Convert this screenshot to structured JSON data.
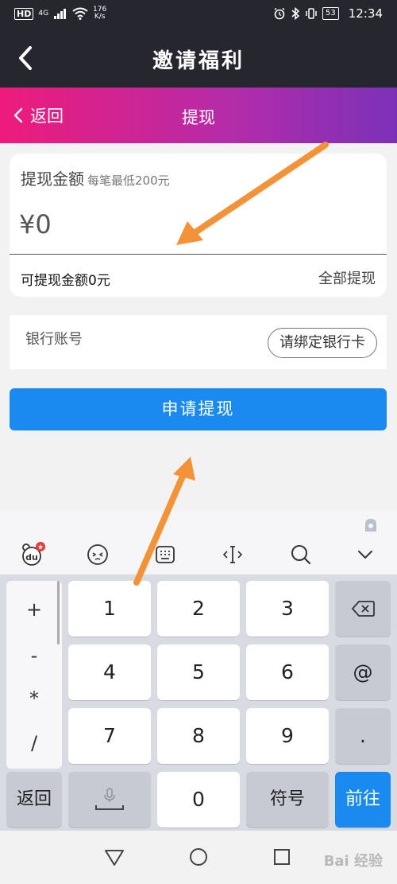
{
  "status_bar": {
    "hd": "HD",
    "signal": "4G",
    "speed_value": "176",
    "speed_unit": "K/s",
    "battery": "53",
    "time": "12:34"
  },
  "app_header": {
    "title": "邀请福利"
  },
  "sub_header": {
    "back_label": "返回",
    "title": "提现"
  },
  "amount": {
    "label": "提现金额",
    "hint": "每笔最低200元",
    "value": "¥0",
    "available": "可提现金额0元",
    "withdraw_all": "全部提现"
  },
  "bank": {
    "label": "银行账号",
    "bind_button": "请绑定银行卡"
  },
  "submit_label": "申请提现",
  "keyboard": {
    "side_keys": [
      "+",
      "-",
      "*",
      "/"
    ],
    "row1": [
      "1",
      "2",
      "3"
    ],
    "row2": [
      "4",
      "5",
      "6"
    ],
    "row3": [
      "7",
      "8",
      "9"
    ],
    "at": "@",
    "dot": ".",
    "return": "返回",
    "zero": "0",
    "symbols": "符号",
    "go": "前往"
  },
  "watermark": "Bai 经验",
  "colors": {
    "accent": "#1a8af0",
    "gradient_start": "#ee1b7a",
    "gradient_end": "#7a31b8",
    "header_bg": "#26262e",
    "arrow": "#f39237"
  }
}
